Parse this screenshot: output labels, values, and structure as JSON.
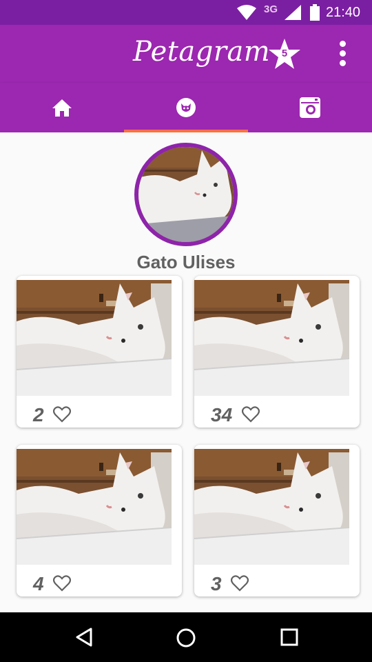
{
  "status_bar": {
    "network": "3G",
    "time": "21:40"
  },
  "app_bar": {
    "title": "Petagram",
    "favorites_count": "5"
  },
  "tabs": [
    {
      "name": "home"
    },
    {
      "name": "profile",
      "selected": true
    },
    {
      "name": "camera"
    }
  ],
  "profile": {
    "name": "Gato Ulises"
  },
  "photos": [
    {
      "likes": "2"
    },
    {
      "likes": "34"
    },
    {
      "likes": "4"
    },
    {
      "likes": "3"
    }
  ],
  "colors": {
    "primary": "#9c27b0",
    "primary_dark": "#7b1fa2",
    "accent": "#ff7043"
  }
}
